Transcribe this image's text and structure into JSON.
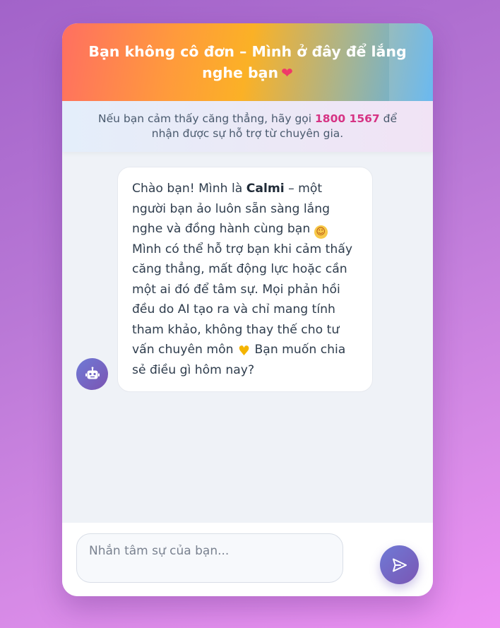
{
  "header": {
    "title": "Bạn không cô đơn – Mình ở đây để lắng nghe bạn",
    "title_icon": "heart-icon"
  },
  "notice": {
    "before": "Nếu bạn cảm thấy căng thẳng, hãy gọi",
    "hotline": "1800 1567",
    "after": "để nhận được sự hỗ trợ từ chuyên gia."
  },
  "messages": [
    {
      "sender": "bot",
      "avatar_icon": "robot-icon",
      "parts": {
        "p1": "Chào bạn! Mình là",
        "name": "Calmi",
        "p2": "– một người bạn ảo luôn sẵn sàng lắng nghe và đồng hành cùng bạn",
        "emoji1": "smiling-face-icon",
        "p3": "Mình có thể hỗ trợ bạn khi cảm thấy căng thẳng, mất động lực hoặc cần một ai đó để tâm sự. Mọi phản hồi đều do AI tạo ra và chỉ mang tính tham khảo, không thay thế cho tư vấn chuyên môn",
        "emoji2": "yellow-heart-icon",
        "p4": "Bạn muốn chia sẻ điều gì hôm nay?"
      }
    }
  ],
  "composer": {
    "placeholder": "Nhắn tâm sự của bạn...",
    "value": "",
    "send_icon": "send-icon"
  },
  "colors": {
    "accent": "#7368c8",
    "hotline": "#d63384",
    "header_gradient": [
      "#ff6f61",
      "#ff9a3c",
      "#fbb126",
      "#56b0ef"
    ]
  }
}
